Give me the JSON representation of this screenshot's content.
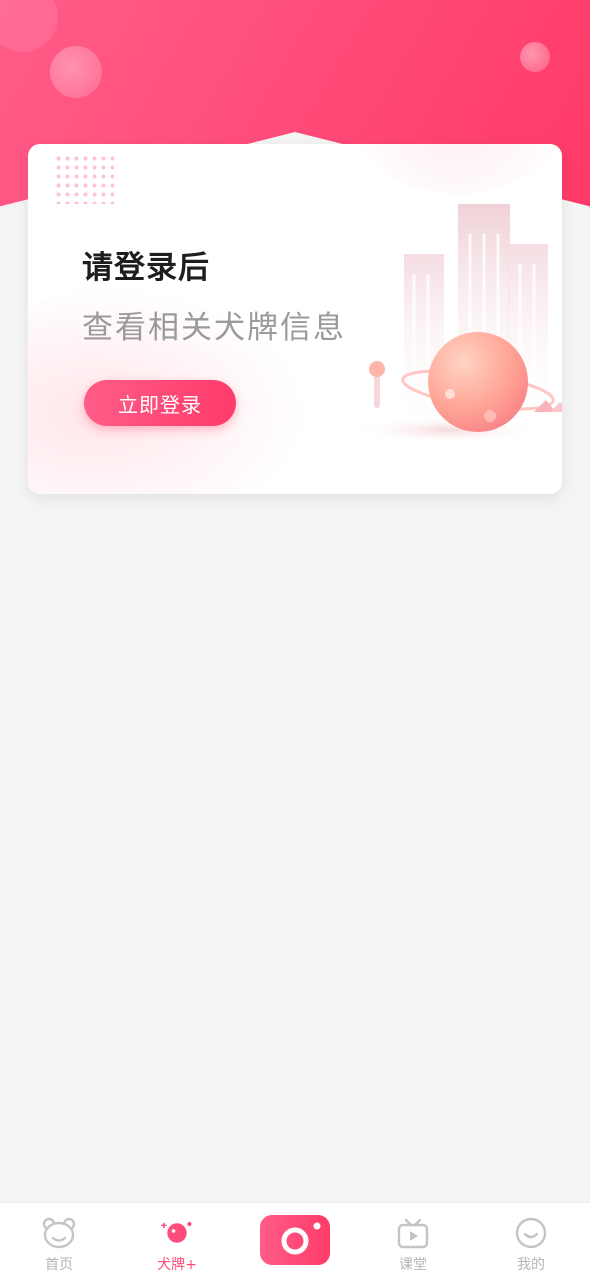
{
  "login_card": {
    "title": "请登录后",
    "subtitle": "查看相关犬牌信息",
    "login_button": "立即登录"
  },
  "tabbar": {
    "items": [
      {
        "label": "首页",
        "icon": "bear-face-icon",
        "active": false
      },
      {
        "label": "犬牌+",
        "icon": "dog-tag-icon",
        "active": true
      },
      {
        "label": "",
        "icon": "camera-icon",
        "active": false
      },
      {
        "label": "课堂",
        "icon": "tv-play-icon",
        "active": false
      },
      {
        "label": "我的",
        "icon": "smile-icon",
        "active": false
      }
    ]
  },
  "colors": {
    "brand_pink": "#ff4d7b",
    "inactive_gray": "#b5b5b5",
    "background": "#f4f4f4"
  }
}
